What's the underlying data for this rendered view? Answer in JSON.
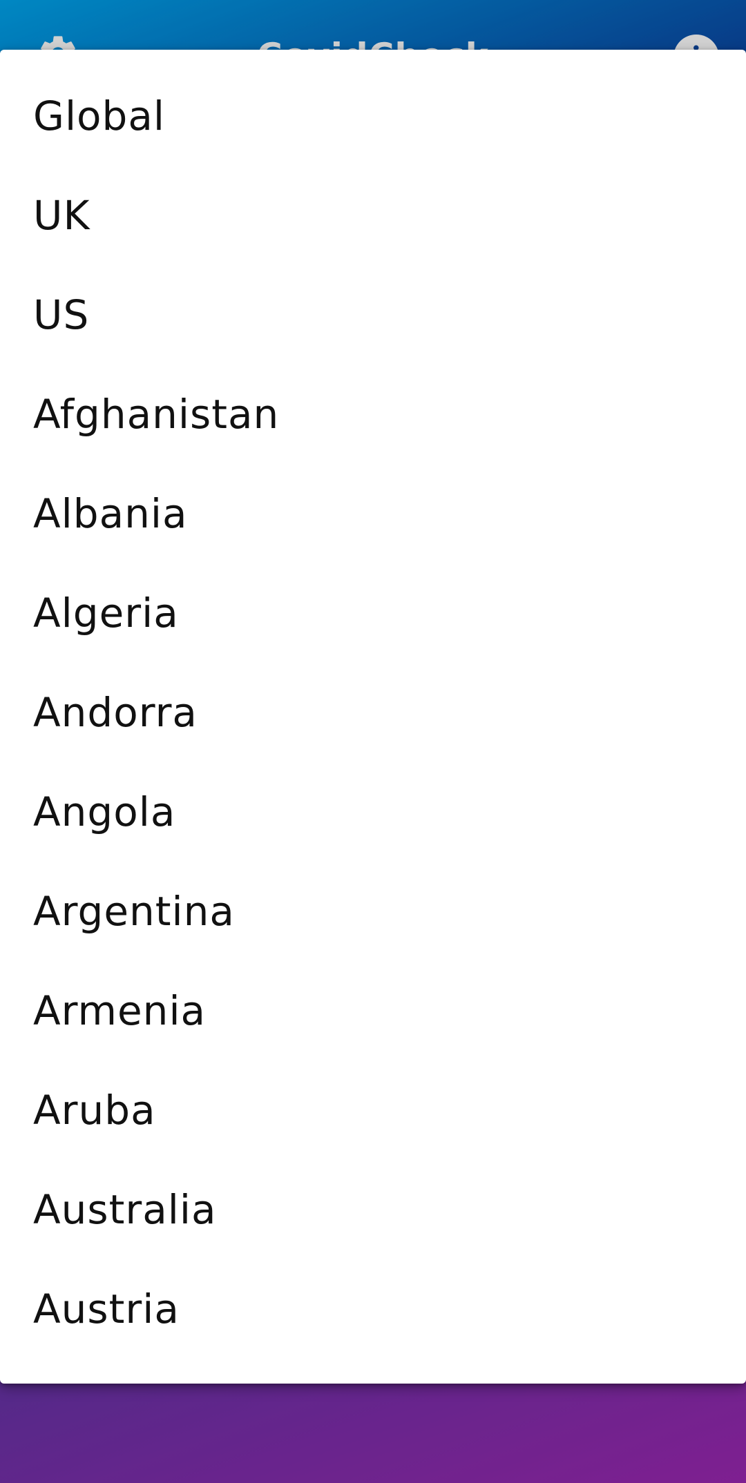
{
  "app_bar": {
    "title": "CovidCheck",
    "settings_icon": "gear-icon",
    "info_icon": "info-icon",
    "info_glyph": "i"
  },
  "colors": {
    "gradient_start": "#00a6ee",
    "gradient_end": "#9b27b1",
    "menu_background": "#ffffff",
    "menu_text": "#111111"
  },
  "country_menu": {
    "items": [
      "Global",
      "UK",
      "US",
      "Afghanistan",
      "Albania",
      "Algeria",
      "Andorra",
      "Angola",
      "Argentina",
      "Armenia",
      "Aruba",
      "Australia",
      "Austria"
    ]
  }
}
